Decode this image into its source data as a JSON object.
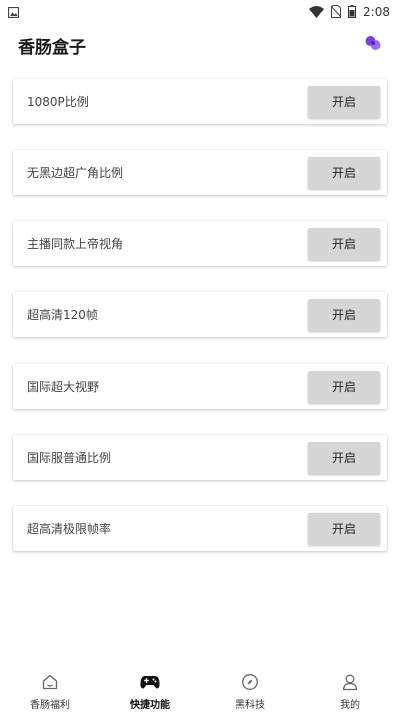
{
  "status_bar": {
    "time": "2:08"
  },
  "app": {
    "title": "香肠盒子"
  },
  "features": [
    {
      "label": "1080P比例",
      "button": "开启"
    },
    {
      "label": "无黑边超广角比例",
      "button": "开启"
    },
    {
      "label": "主播同款上帝视角",
      "button": "开启"
    },
    {
      "label": "超高清120帧",
      "button": "开启"
    },
    {
      "label": "国际超大视野",
      "button": "开启"
    },
    {
      "label": "国际服普通比例",
      "button": "开启"
    },
    {
      "label": "超高清极限帧率",
      "button": "开启"
    }
  ],
  "bottom_nav": [
    {
      "label": "香肠福利",
      "icon": "home-icon"
    },
    {
      "label": "快捷功能",
      "icon": "gamepad-icon",
      "active": true
    },
    {
      "label": "黑科技",
      "icon": "compass-icon"
    },
    {
      "label": "我的",
      "icon": "profile-icon"
    }
  ],
  "colors": {
    "accent": "#7b3fe4",
    "button_bg": "#d6d6d6",
    "background": "#ffffff"
  }
}
